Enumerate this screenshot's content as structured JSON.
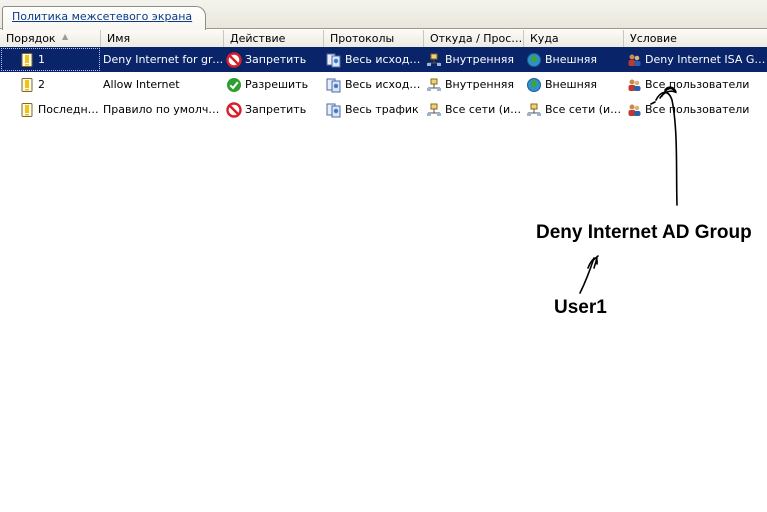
{
  "tab": {
    "label": "Политика межсетевого экрана"
  },
  "columns": [
    "Порядок",
    "Имя",
    "Действие",
    "Протоколы",
    "Откуда / Прос…",
    "Куда",
    "Условие"
  ],
  "rows": [
    {
      "order": "1",
      "name": "Deny Internet for group",
      "action": "Запретить",
      "action_icon": "deny-icon",
      "protocols": "Весь исходя…",
      "from": "Внутренняя",
      "to": "Внешняя",
      "condition": "Deny Internet ISA Group",
      "selected": true
    },
    {
      "order": "2",
      "name": "Allow Internet",
      "action": "Разрешить",
      "action_icon": "allow-icon",
      "protocols": "Весь исходя…",
      "from": "Внутренняя",
      "to": "Внешняя",
      "condition": "Все пользователи",
      "selected": false
    },
    {
      "order": "Последний",
      "name": "Правило по умолчанию",
      "action": "Запретить",
      "action_icon": "deny-icon",
      "protocols": "Весь трафик",
      "from": "Все сети (и л…",
      "to": "Все сети (и л…",
      "condition": "Все пользователи",
      "selected": false
    }
  ],
  "annotations": {
    "group_label": "Deny Internet AD Group",
    "user_label": "User1"
  },
  "colors": {
    "selection": "#0a246a",
    "tab_text": "#0b3a8a",
    "deny": "#d9202a",
    "allow": "#2e9e2e"
  }
}
